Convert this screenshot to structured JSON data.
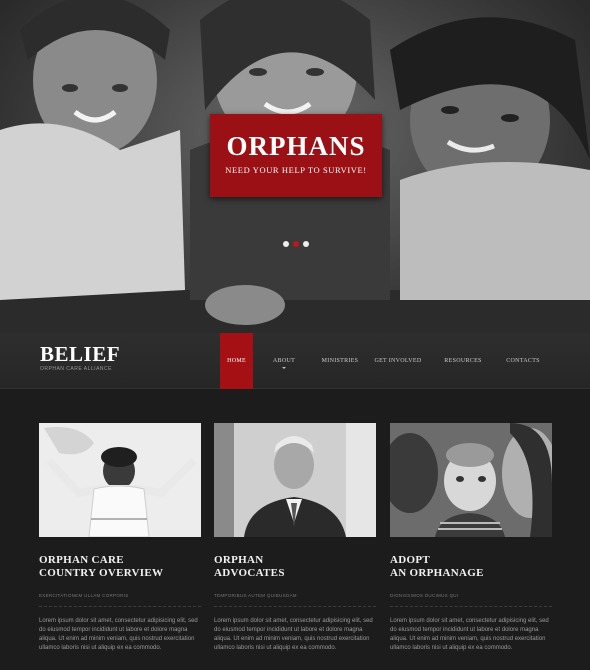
{
  "hero": {
    "banner_title": "ORPHANS",
    "banner_subtitle": "NEED YOUR HELP TO SURVIVE!",
    "slides": 3,
    "active_slide": 2
  },
  "brand": {
    "name": "BELIEF",
    "tagline": "ORPHAN CARE ALLIANCE"
  },
  "nav": {
    "items": [
      {
        "label": "HOME",
        "active": true
      },
      {
        "label": "ABOUT",
        "has_dropdown": true
      },
      {
        "label": "MINISTRIES"
      },
      {
        "label": "GET INVOLVED"
      },
      {
        "label": "RESOURCES"
      },
      {
        "label": "CONTACTS"
      }
    ]
  },
  "cards": [
    {
      "title_line1": "ORPHAN CARE",
      "title_line2": "COUNTRY OVERVIEW",
      "subtitle": "EXERCITATIONEM ULLAM CORPORIS",
      "body": "Lorem ipsum dolor sit amet, consectetur adipisicing elit, sed do eiusmod tempor incididunt ut labore et dolore magna aliqua. Ut enim ad minim veniam, quis nostrud exercitation ullamco laboris nisi ut aliquip ex ea commodo."
    },
    {
      "title_line1": "ORPHAN",
      "title_line2": "ADVOCATES",
      "subtitle": "TEMPORIBUS AUTEM QUIBUSDAM",
      "body": "Lorem ipsum dolor sit amet, consectetur adipisicing elit, sed do eiusmod tempor incididunt ut labore et dolore magna aliqua. Ut enim ad minim veniam, quis nostrud exercitation ullamco laboris nisi ut aliquip ex ea commodo."
    },
    {
      "title_line1": "ADOPT",
      "title_line2": "AN ORPHANAGE",
      "subtitle": "DIGNISSIMOS DUCIMUS QUI",
      "body": "Lorem ipsum dolor sit amet, consectetur adipisicing elit, sed do eiusmod tempor incididunt ut labore et dolore magna aliqua. Ut enim ad minim veniam, quis nostrud exercitation ullamco laboris nisi ut aliquip ex ea commodo."
    }
  ],
  "colors": {
    "accent": "#a51014",
    "background": "#1c1c1c",
    "navbar": "#2a2a2a"
  }
}
